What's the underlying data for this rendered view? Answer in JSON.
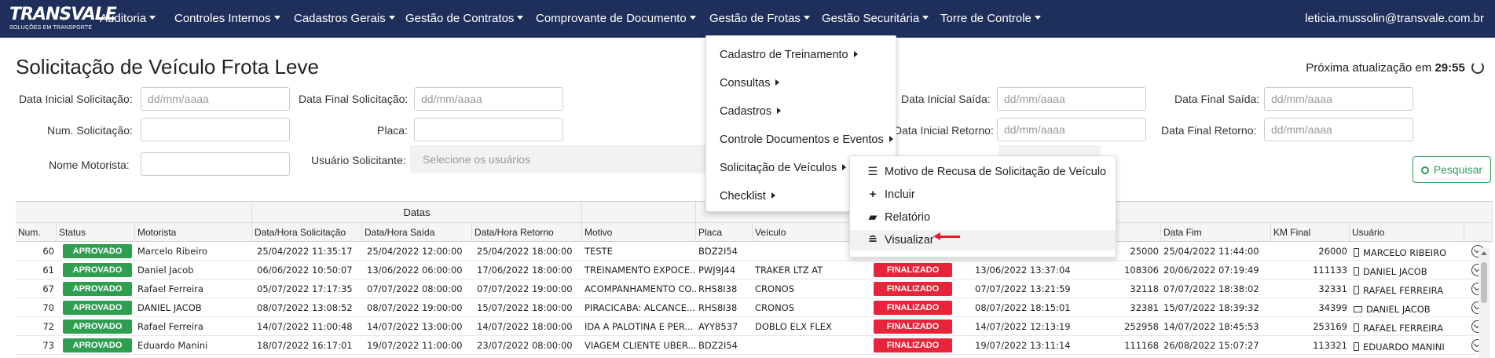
{
  "navbar": {
    "logo_text": "TRANSVALE",
    "logo_sub": "SOLUÇÕES EM TRANSPORTE",
    "items": [
      "Auditoria",
      "Controles Internos",
      "Cadastros Gerais",
      "Gestão de Contratos",
      "Comprovante de Documento",
      "Gestão de Frotas",
      "Gestão Securitária",
      "Torre de Controle"
    ],
    "user": "leticia.mussolin@transvale.com.br"
  },
  "page": {
    "title": "Solicitação de Veículo Frota Leve",
    "refresh_label": "Próxima atualização em",
    "refresh_time": "29:55"
  },
  "form": {
    "data_inicial_solicitacao": "Data Inicial Solicitação:",
    "data_final_solicitacao": "Data Final Solicitação:",
    "data_inicial_saida": "Data Inicial Saída:",
    "data_final_saida": "Data Final Saída:",
    "num_solicitacao": "Num. Solicitação:",
    "placa": "Placa:",
    "data_inicial_retorno": "Data Inicial Retorno:",
    "data_final_retorno": "Data Final Retorno:",
    "nome_motorista": "Nome Motorista:",
    "usuario_solicitante": "Usuário Solicitante:",
    "date_placeholder": "dd/mm/aaaa",
    "users_placeholder": "Selecione os usuários",
    "search_button": "Pesquisar"
  },
  "table": {
    "group_header": "Datas",
    "columns": [
      "Num.",
      "Status",
      "Motorista",
      "Data/Hora Solicitação",
      "Data/Hora Saída",
      "Data/Hora Retorno",
      "Motivo",
      "Placa",
      "Veículo",
      "Data Fim",
      "KM Final",
      "Usuário"
    ],
    "rows": [
      {
        "num": "60",
        "status": "APROVADO",
        "motorista": "Marcelo Ribeiro",
        "solicitacao": "25/04/2022 11:35:17",
        "saida": "25/04/2022 12:00:00",
        "retorno": "25/04/2022 18:00:00",
        "motivo": "TESTE",
        "placa": "BDZ2I54",
        "veiculo": "",
        "status2": "",
        "inicio": "",
        "km_inicial": "25000",
        "fim": "25/04/2022 11:44:00",
        "km_final": "26000",
        "usuario": "MARCELO RIBEIRO",
        "device": "phone"
      },
      {
        "num": "61",
        "status": "APROVADO",
        "motorista": "Daniel Jacob",
        "solicitacao": "06/06/2022 10:50:07",
        "saida": "13/06/2022 06:00:00",
        "retorno": "17/06/2022 18:00:00",
        "motivo": "TREINAMENTO EXPOCE...",
        "placa": "PWJ9J44",
        "veiculo": "TRAKER LTZ AT",
        "status2": "FINALIZADO",
        "inicio": "13/06/2022 13:37:04",
        "km_inicial": "108306",
        "fim": "20/06/2022 07:19:49",
        "km_final": "111133",
        "usuario": "DANIEL JACOB",
        "device": "phone"
      },
      {
        "num": "67",
        "status": "APROVADO",
        "motorista": "Rafael Ferreira",
        "solicitacao": "05/07/2022 17:17:35",
        "saida": "07/07/2022 08:00:00",
        "retorno": "07/07/2022 19:00:00",
        "motivo": "ACOMPANHAMENTO CO...",
        "placa": "RHS8I38",
        "veiculo": "CRONOS",
        "status2": "FINALIZADO",
        "inicio": "07/07/2022 13:21:59",
        "km_inicial": "32118",
        "fim": "07/07/2022 18:38:02",
        "km_final": "32331",
        "usuario": "RAFAEL FERREIRA",
        "device": "phone"
      },
      {
        "num": "70",
        "status": "APROVADO",
        "motorista": "DANIEL JACOB",
        "solicitacao": "08/07/2022 13:08:52",
        "saida": "08/07/2022 19:00:00",
        "retorno": "15/07/2022 18:00:00",
        "motivo": "PIRACICABA: ALCANCE...",
        "placa": "RHS8I38",
        "veiculo": "CRONOS",
        "status2": "FINALIZADO",
        "inicio": "08/07/2022 18:15:01",
        "km_inicial": "32381",
        "fim": "15/07/2022 18:39:32",
        "km_final": "34399",
        "usuario": "DANIEL JACOB",
        "device": "monitor"
      },
      {
        "num": "72",
        "status": "APROVADO",
        "motorista": "Rafael Ferreira",
        "solicitacao": "14/07/2022 11:00:48",
        "saida": "14/07/2022 13:00:00",
        "retorno": "14/07/2022 18:00:00",
        "motivo": "IDA A PALOTINA E PER...",
        "placa": "AYY8537",
        "veiculo": "DOBLO ELX FLEX",
        "status2": "FINALIZADO",
        "inicio": "14/07/2022 12:13:19",
        "km_inicial": "252958",
        "fim": "14/07/2022 18:45:53",
        "km_final": "253169",
        "usuario": "RAFAEL FERREIRA",
        "device": "phone"
      },
      {
        "num": "73",
        "status": "APROVADO",
        "motorista": "Eduardo Manini",
        "solicitacao": "18/07/2022 16:17:01",
        "saida": "19/07/2022 11:00:00",
        "retorno": "23/07/2022 08:00:00",
        "motivo": "VIAGEM CLIENTE UBER...",
        "placa": "BDZ2I54",
        "veiculo": "",
        "status2": "FINALIZADO",
        "inicio": "19/07/2022 13:11:14",
        "km_inicial": "111168",
        "fim": "26/08/2022 15:07:27",
        "km_final": "113321",
        "usuario": "EDUARDO MANINI",
        "device": "phone"
      }
    ]
  },
  "menu": {
    "items": [
      "Cadastro de Treinamento",
      "Consultas",
      "Cadastros",
      "Controle Documentos e Eventos",
      "Solicitação de Veículos",
      "Checklist"
    ]
  },
  "submenu": {
    "items": [
      {
        "label": "Motivo de Recusa de Solicitação de Veículo",
        "icon": "list-icon"
      },
      {
        "label": "Incluir",
        "icon": "plus-icon"
      },
      {
        "label": "Relatório",
        "icon": "book-icon"
      },
      {
        "label": "Visualizar",
        "icon": "align-center-icon"
      }
    ]
  },
  "colors": {
    "navbar": "#1e2f5c",
    "approved": "#2e9e4f",
    "finalized": "#e8243a",
    "search_button": "#2e9e5b",
    "arrow": "#e01e2f"
  }
}
